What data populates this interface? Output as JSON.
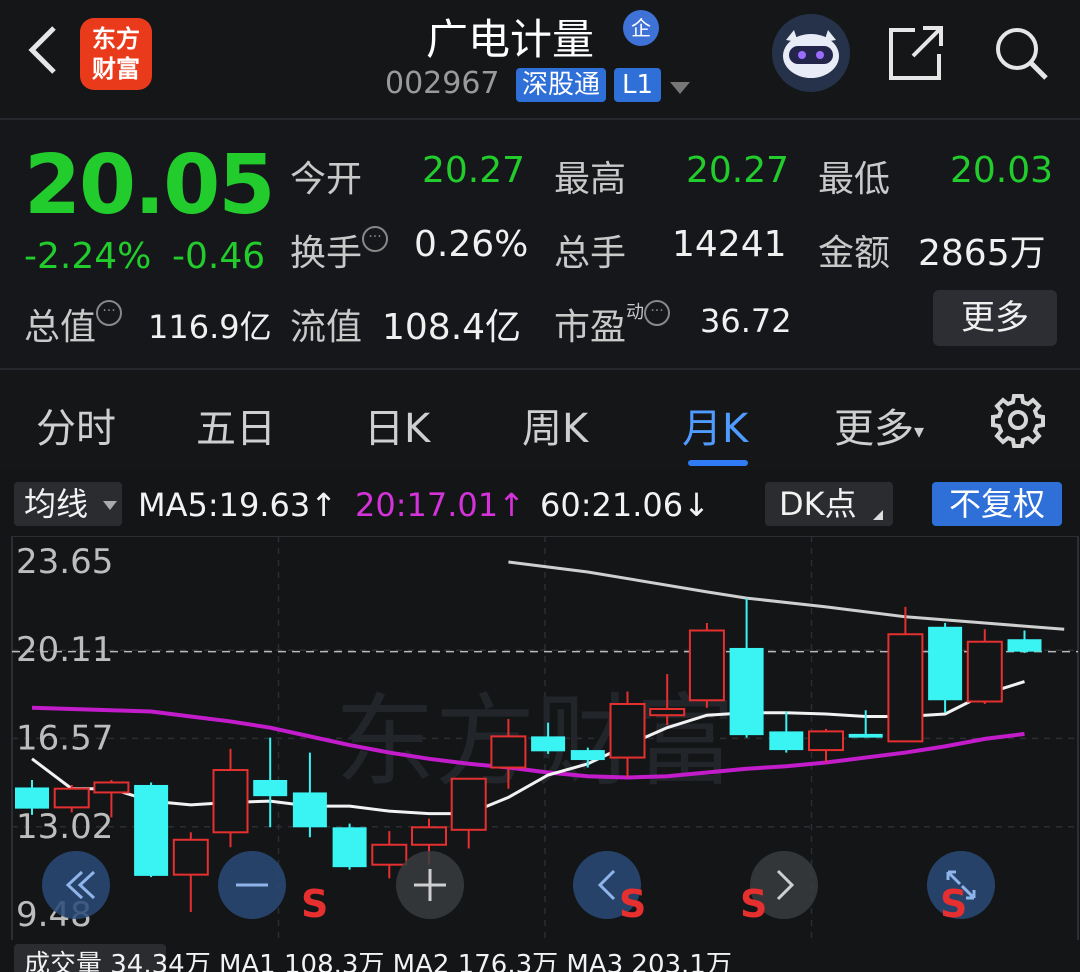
{
  "header": {
    "logo_text_top": "东方",
    "logo_text_bottom": "财富",
    "stock_name": "广电计量",
    "badge_qi": "企",
    "code": "002967",
    "tag_connect": "深股通",
    "tag_level": "L1"
  },
  "quote": {
    "price": "20.05",
    "change_pct": "-2.24%",
    "change_abs": "-0.46",
    "rows": [
      [
        {
          "label": "今开",
          "value": "20.27"
        },
        {
          "label": "最高",
          "value": "20.27"
        },
        {
          "label": "最低",
          "value": "20.03"
        }
      ],
      [
        {
          "label": "换手",
          "value": "0.26%"
        },
        {
          "label": "总手",
          "value": "14241"
        },
        {
          "label": "金额",
          "value": "2865万"
        }
      ]
    ],
    "total_value_label": "总值",
    "total_value": "116.9亿",
    "float_value_label": "流值",
    "float_value": "108.4亿",
    "pe_label": "市盈",
    "pe_sup": "动",
    "pe_value": "36.72",
    "more_button": "更多",
    "colors": {
      "down": "#22cc2d"
    }
  },
  "tabs": {
    "items": [
      "分时",
      "五日",
      "日K",
      "周K",
      "月K",
      "更多"
    ],
    "active": "月K"
  },
  "ma_bar": {
    "selector": "均线",
    "ma5": "MA5:19.63↑",
    "ma20": "20:17.01↑",
    "ma60": "60:21.06↓",
    "dk_button": "DK点",
    "fq_button": "不复权"
  },
  "chart_data": {
    "type": "candlestick",
    "y_ticks": [
      "23.65",
      "20.11",
      "16.57",
      "13.02",
      "9.48"
    ],
    "ylim": [
      9.48,
      23.65
    ],
    "watermark": "东方财富",
    "up_color": "#e5302f",
    "down_color": "#3af3f3",
    "current_price_line": 20.05,
    "candles": [
      {
        "o": 14.6,
        "c": 13.75,
        "h": 14.9,
        "l": 13.5
      },
      {
        "o": 13.8,
        "c": 14.55,
        "h": 14.7,
        "l": 13.6
      },
      {
        "o": 14.4,
        "c": 14.8,
        "h": 14.9,
        "l": 13.4
      },
      {
        "o": 14.7,
        "c": 11.05,
        "h": 14.8,
        "l": 11.0
      },
      {
        "o": 11.1,
        "c": 12.5,
        "h": 12.8,
        "l": 9.6
      },
      {
        "o": 12.8,
        "c": 15.3,
        "h": 16.15,
        "l": 12.2
      },
      {
        "o": 14.9,
        "c": 14.25,
        "h": 16.6,
        "l": 13.0
      },
      {
        "o": 14.4,
        "c": 13.0,
        "h": 16.0,
        "l": 12.6
      },
      {
        "o": 13.0,
        "c": 11.4,
        "h": 13.15,
        "l": 11.3
      },
      {
        "o": 11.5,
        "c": 12.3,
        "h": 12.85,
        "l": 10.95
      },
      {
        "o": 12.3,
        "c": 13.0,
        "h": 13.35,
        "l": 11.5
      },
      {
        "o": 12.9,
        "c": 14.95,
        "h": 14.95,
        "l": 12.15
      },
      {
        "o": 15.4,
        "c": 16.65,
        "h": 17.35,
        "l": 14.55
      },
      {
        "o": 16.65,
        "c": 16.05,
        "h": 17.2,
        "l": 15.95
      },
      {
        "o": 16.1,
        "c": 15.7,
        "h": 16.2,
        "l": 15.4
      },
      {
        "o": 15.8,
        "c": 17.95,
        "h": 18.45,
        "l": 15.0
      },
      {
        "o": 17.5,
        "c": 17.75,
        "h": 19.15,
        "l": 17.1
      },
      {
        "o": 18.1,
        "c": 20.9,
        "h": 21.2,
        "l": 17.8
      },
      {
        "o": 20.2,
        "c": 16.7,
        "h": 22.2,
        "l": 16.6
      },
      {
        "o": 16.85,
        "c": 16.1,
        "h": 17.65,
        "l": 16.0
      },
      {
        "o": 16.1,
        "c": 16.85,
        "h": 16.95,
        "l": 15.6
      },
      {
        "o": 16.75,
        "c": 16.6,
        "h": 17.7,
        "l": 16.6
      },
      {
        "o": 16.45,
        "c": 20.75,
        "h": 21.85,
        "l": 16.45
      },
      {
        "o": 21.05,
        "c": 18.1,
        "h": 21.2,
        "l": 17.6
      },
      {
        "o": 18.05,
        "c": 20.45,
        "h": 20.95,
        "l": 17.95
      },
      {
        "o": 20.55,
        "c": 20.05,
        "h": 20.9,
        "l": 20.0
      }
    ],
    "ma5": [
      15.75,
      14.55,
      14.55,
      14.05,
      13.9,
      14.0,
      14.05,
      13.85,
      13.85,
      13.65,
      13.55,
      13.55,
      14.2,
      15.1,
      15.55,
      16.3,
      17.0,
      17.5,
      17.6,
      17.6,
      17.55,
      17.45,
      17.45,
      17.55,
      18.35,
      18.85
    ],
    "ma20": [
      17.8,
      17.75,
      17.7,
      17.65,
      17.45,
      17.25,
      17.0,
      16.65,
      16.3,
      16.0,
      15.75,
      15.55,
      15.4,
      15.2,
      15.05,
      15.0,
      15.05,
      15.2,
      15.35,
      15.45,
      15.6,
      15.8,
      16.0,
      16.25,
      16.55,
      16.75
    ],
    "ma60_partial": [
      [
        12,
        23.65
      ],
      [
        14,
        23.25
      ],
      [
        17,
        22.45
      ],
      [
        18,
        22.2
      ],
      [
        20,
        21.85
      ],
      [
        22,
        21.45
      ],
      [
        24,
        21.2
      ],
      [
        26,
        20.95
      ]
    ]
  },
  "bottom": {
    "text": "成交量 34.34万 MA1 108.3万 MA2 176.3万 MA3 203.1万"
  }
}
